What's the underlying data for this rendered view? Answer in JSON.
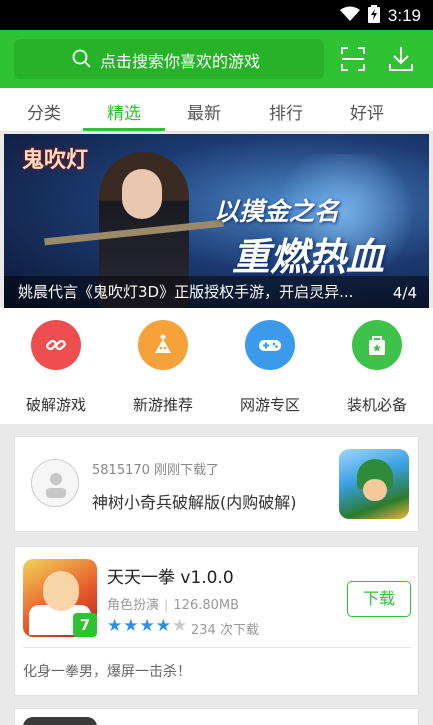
{
  "status_bar": {
    "time": "3:19",
    "wifi_icon": "wifi-icon",
    "battery_icon": "battery-icon"
  },
  "header": {
    "search_placeholder": "点击搜索你喜欢的游戏",
    "search_icon": "search-icon",
    "scan_icon": "scan-icon",
    "download_icon": "download-icon",
    "color": "#2fc232"
  },
  "tabs": [
    {
      "label": "分类"
    },
    {
      "label": "精选",
      "active": true
    },
    {
      "label": "最新"
    },
    {
      "label": "排行"
    },
    {
      "label": "好评"
    }
  ],
  "banner": {
    "logo_text": "鬼吹灯",
    "slogan_line1": "以摸金之名",
    "slogan_line2": "重燃热血",
    "caption": "姚晨代言《鬼吹灯3D》正版授权手游，开启灵异...",
    "pager": "4/4"
  },
  "shortcuts": [
    {
      "label": "破解游戏",
      "icon": "link-icon",
      "color": "#ee4e4e"
    },
    {
      "label": "新游推荐",
      "icon": "sparkle-icon",
      "color": "#f5a23a"
    },
    {
      "label": "网游专区",
      "icon": "gamepad-icon",
      "color": "#3b9bea"
    },
    {
      "label": "装机必备",
      "icon": "bag-icon",
      "color": "#3fc24a"
    }
  ],
  "recent_download": {
    "user_text": "5815170 刚刚下载了",
    "game_name": "神树小奇兵破解版(内购破解)"
  },
  "game": {
    "title": "天天一拳 v1.0.0",
    "category": "角色扮演",
    "size": "126.80MB",
    "rating": 4,
    "rating_max": 5,
    "downloads": "234 次下载",
    "download_button": "下载",
    "badge": "7",
    "description": "化身一拳男，爆屏一击杀！"
  }
}
